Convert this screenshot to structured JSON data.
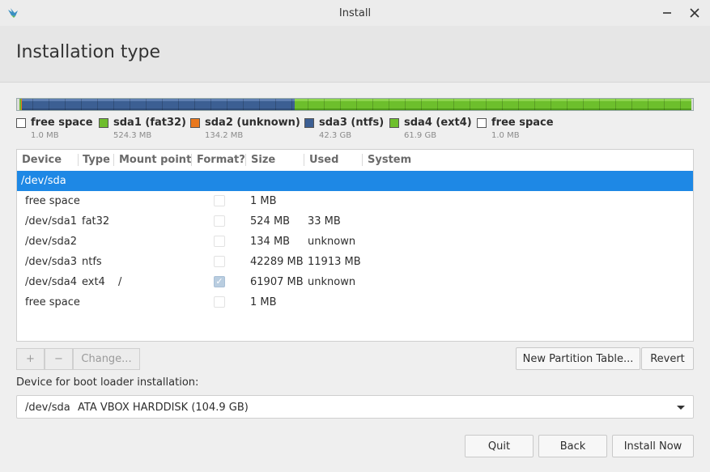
{
  "window": {
    "title": "Install"
  },
  "header": {
    "title": "Installation type"
  },
  "legend": [
    {
      "name": "free space",
      "size": "1.0 MB",
      "color": "#ffffff"
    },
    {
      "name": "sda1 (fat32)",
      "size": "524.3 MB",
      "color": "#6fbd2e"
    },
    {
      "name": "sda2 (unknown)",
      "size": "134.2 MB",
      "color": "#e8781e"
    },
    {
      "name": "sda3 (ntfs)",
      "size": "42.3 GB",
      "color": "#3c5f93"
    },
    {
      "name": "sda4 (ext4)",
      "size": "61.9 GB",
      "color": "#6dbf2c"
    },
    {
      "name": "free space",
      "size": "1.0 MB",
      "color": "#ffffff"
    }
  ],
  "table": {
    "columns": [
      "Device",
      "Type",
      "Mount point",
      "Format?",
      "Size",
      "Used",
      "System"
    ],
    "rows": [
      {
        "device": "/dev/sda",
        "type": "",
        "mount": "",
        "format": null,
        "size": "",
        "used": "",
        "system": "",
        "selected": true
      },
      {
        "device": "free space",
        "type": "",
        "mount": "",
        "format": false,
        "size": "1 MB",
        "used": "",
        "system": ""
      },
      {
        "device": "/dev/sda1",
        "type": "fat32",
        "mount": "",
        "format": false,
        "size": "524 MB",
        "used": "33 MB",
        "system": ""
      },
      {
        "device": "/dev/sda2",
        "type": "",
        "mount": "",
        "format": false,
        "size": "134 MB",
        "used": "unknown",
        "system": ""
      },
      {
        "device": "/dev/sda3",
        "type": "ntfs",
        "mount": "",
        "format": false,
        "size": "42289 MB",
        "used": "11913 MB",
        "system": ""
      },
      {
        "device": "/dev/sda4",
        "type": "ext4",
        "mount": "/",
        "format": true,
        "size": "61907 MB",
        "used": "unknown",
        "system": ""
      },
      {
        "device": "free space",
        "type": "",
        "mount": "",
        "format": false,
        "size": "1 MB",
        "used": "",
        "system": ""
      }
    ]
  },
  "toolbar": {
    "add": "+",
    "remove": "−",
    "change": "Change...",
    "new_table": "New Partition Table...",
    "revert": "Revert"
  },
  "boot": {
    "label": "Device for boot loader installation:",
    "device": "/dev/sda",
    "description": "ATA VBOX HARDDISK (104.9 GB)"
  },
  "footer": {
    "quit": "Quit",
    "back": "Back",
    "install": "Install Now"
  },
  "colors": {
    "accent": "#1e88e5"
  }
}
